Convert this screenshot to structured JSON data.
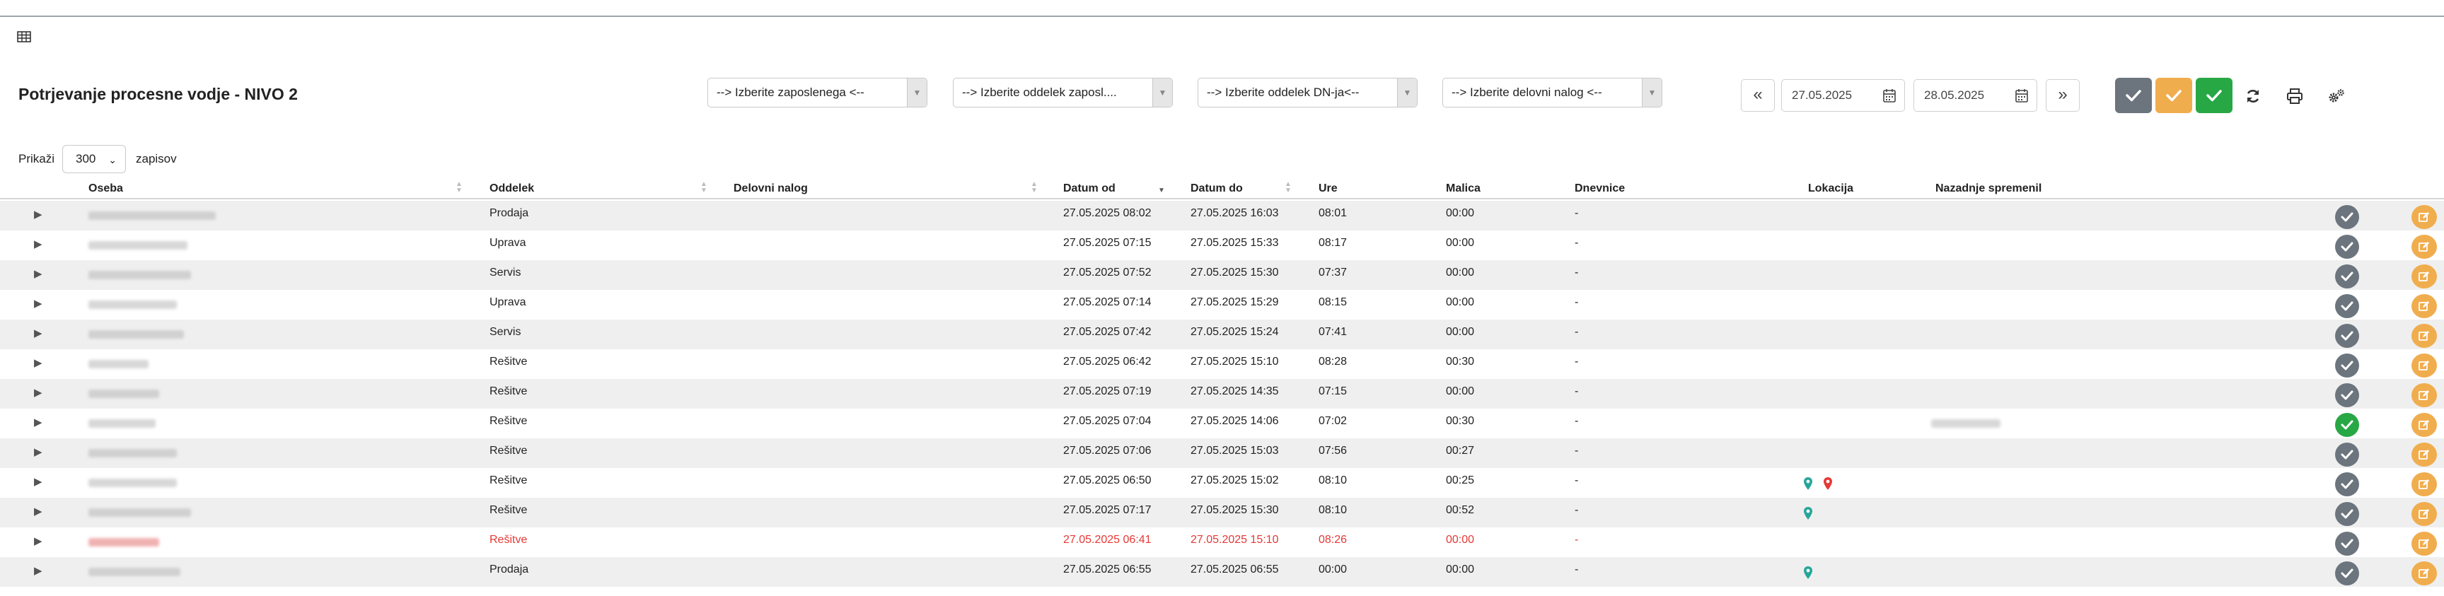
{
  "page": {
    "title": "Potrjevanje procesne vodje - NIVO 2"
  },
  "filters": {
    "employee": "--> Izberite zaposlenega <--",
    "employee_dept": "--> Izberite oddelek zaposl....",
    "dn_dept": "--> Izberite oddelek DN-ja<--",
    "work_order": "--> Izberite delovni nalog <--"
  },
  "dates": {
    "from": "27.05.2025",
    "to": "28.05.2025"
  },
  "nav": {
    "prev": "«",
    "next": "»"
  },
  "page_size": {
    "prefix": "Prikaži",
    "value": "300",
    "suffix": "zapisov"
  },
  "columns": {
    "oseba": "Oseba",
    "oddelek": "Oddelek",
    "delovni_nalog": "Delovni nalog",
    "datum_od": "Datum od",
    "datum_do": "Datum do",
    "ure": "Ure",
    "malica": "Malica",
    "dnevnice": "Dnevnice",
    "lokacija": "Lokacija",
    "nazadnje_spremenil": "Nazadnje spremenil"
  },
  "colors": {
    "gray_btn": "#6c757d",
    "orange_btn": "#f0ad4e",
    "green_btn": "#28a745",
    "red_text": "#e53935",
    "pin_teal": "#26a69a",
    "pin_red": "#e53935"
  },
  "rows": [
    {
      "oddelek": "Prodaja",
      "od": "27.05.2025 08:02",
      "do": "27.05.2025 16:03",
      "ure": "08:01",
      "malica": "00:00",
      "dnevnice": "-"
    },
    {
      "oddelek": "Uprava",
      "od": "27.05.2025 07:15",
      "do": "27.05.2025 15:33",
      "ure": "08:17",
      "malica": "00:00",
      "dnevnice": "-"
    },
    {
      "oddelek": "Servis",
      "od": "27.05.2025 07:52",
      "do": "27.05.2025 15:30",
      "ure": "07:37",
      "malica": "00:00",
      "dnevnice": "-"
    },
    {
      "oddelek": "Uprava",
      "od": "27.05.2025 07:14",
      "do": "27.05.2025 15:29",
      "ure": "08:15",
      "malica": "00:00",
      "dnevnice": "-"
    },
    {
      "oddelek": "Servis",
      "od": "27.05.2025 07:42",
      "do": "27.05.2025 15:24",
      "ure": "07:41",
      "malica": "00:00",
      "dnevnice": "-"
    },
    {
      "oddelek": "Rešitve",
      "od": "27.05.2025 06:42",
      "do": "27.05.2025 15:10",
      "ure": "08:28",
      "malica": "00:30",
      "dnevnice": "-"
    },
    {
      "oddelek": "Rešitve",
      "od": "27.05.2025 07:19",
      "do": "27.05.2025 14:35",
      "ure": "07:15",
      "malica": "00:00",
      "dnevnice": "-"
    },
    {
      "oddelek": "Rešitve",
      "od": "27.05.2025 07:04",
      "do": "27.05.2025 14:06",
      "ure": "07:02",
      "malica": "00:30",
      "dnevnice": "-"
    },
    {
      "oddelek": "Rešitve",
      "od": "27.05.2025 07:06",
      "do": "27.05.2025 15:03",
      "ure": "07:56",
      "malica": "00:27",
      "dnevnice": "-"
    },
    {
      "oddelek": "Rešitve",
      "od": "27.05.2025 06:50",
      "do": "27.05.2025 15:02",
      "ure": "08:10",
      "malica": "00:25",
      "dnevnice": "-"
    },
    {
      "oddelek": "Rešitve",
      "od": "27.05.2025 07:17",
      "do": "27.05.2025 15:30",
      "ure": "08:10",
      "malica": "00:52",
      "dnevnice": "-"
    },
    {
      "oddelek": "Rešitve",
      "od": "27.05.2025 06:41",
      "do": "27.05.2025 15:10",
      "ure": "08:26",
      "malica": "00:00",
      "dnevnice": "-"
    },
    {
      "oddelek": "Prodaja",
      "od": "27.05.2025 06:55",
      "do": "27.05.2025 06:55",
      "ure": "00:00",
      "malica": "00:00",
      "dnevnice": "-"
    }
  ]
}
